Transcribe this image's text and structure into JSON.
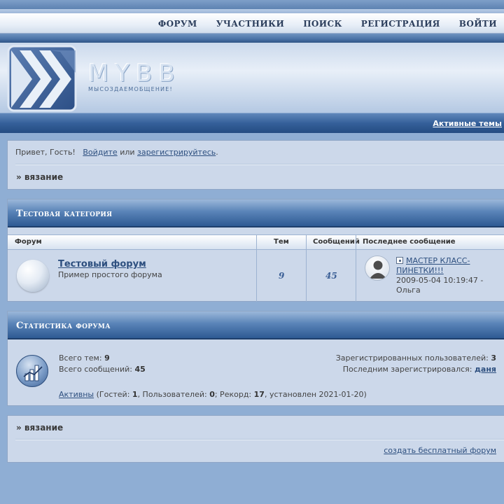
{
  "nav": {
    "items": [
      {
        "id": "forum",
        "label": "ФОРУМ"
      },
      {
        "id": "members",
        "label": "УЧАСТНИКИ"
      },
      {
        "id": "search",
        "label": "ПОИСК"
      },
      {
        "id": "register",
        "label": "РЕГИСТРАЦИЯ"
      },
      {
        "id": "login",
        "label": "ВОЙТИ"
      }
    ]
  },
  "logo": {
    "text": "MYBB",
    "slogan": "МЫСОЗДАЕМОБЩЕНИЕ!"
  },
  "subbar": {
    "active_topics": "Активные темы"
  },
  "welcome": {
    "greeting": "Привет, Гость!",
    "login_link": "Войдите",
    "or": "или",
    "register_link": "зарегистрируйтесь",
    "period": ".",
    "breadcrumb": "» вязание"
  },
  "category": {
    "title": "Тестовая категория",
    "columns": {
      "forum": "Форум",
      "topics": "Тем",
      "posts": "Сообщений",
      "last_post": "Последнее сообщение"
    },
    "forums": [
      {
        "name": "Тестовый форум",
        "description": "Пример простого форума",
        "topics": "9",
        "posts": "45",
        "last_post": {
          "title": "МАСТЕР КЛАСС-ПИНЕТКИ!!!",
          "datetime": "2009-05-04 10:19:47 -",
          "author": "Ольга"
        }
      }
    ]
  },
  "stats": {
    "title": "Статистика форума",
    "topics_label": "Всего тем:",
    "topics_value": "9",
    "posts_label": "Всего сообщений:",
    "posts_value": "45",
    "registered_label": "Зарегистрированных пользователей:",
    "registered_value": "3",
    "last_registered_label": "Последним зарегистрировался:",
    "last_registered_user": "даня",
    "active_link": "Активны",
    "guests_prefix": "(Гостей:",
    "guests_value": "1",
    "users_prefix": ", Пользователей:",
    "users_value": "0",
    "record_prefix": "; Рекорд:",
    "record_value": "17",
    "record_suffix": ", установлен 2021-01-20)"
  },
  "footer": {
    "breadcrumb": "» вязание",
    "create_forum_link": "создать бесплатный форум"
  }
}
